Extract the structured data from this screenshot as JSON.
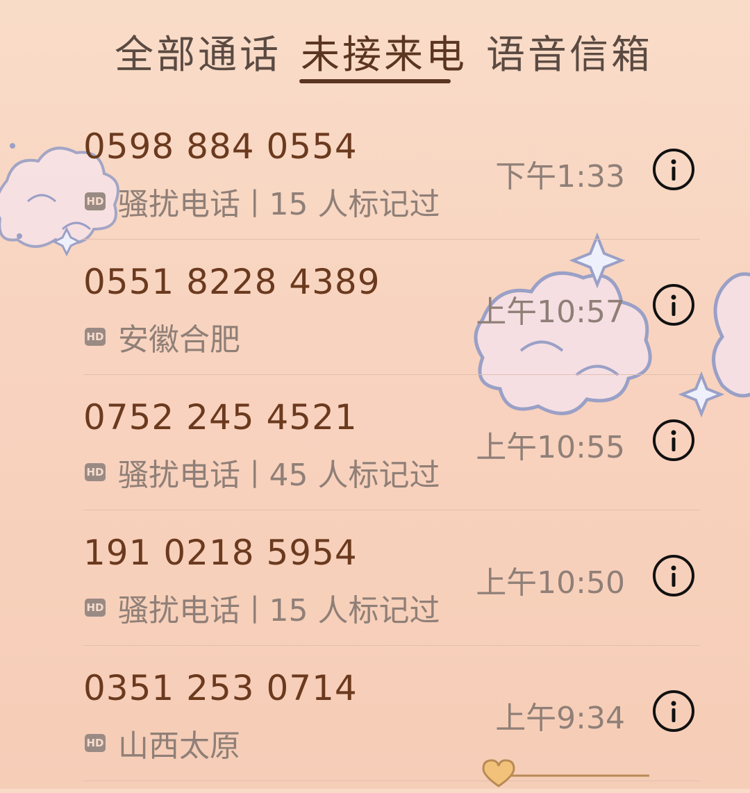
{
  "tabs": {
    "all": "全部通话",
    "missed": "未接来电",
    "voicemail": "语音信箱",
    "active": "missed"
  },
  "calls": [
    {
      "number": "0598 884 0554",
      "hd": "HD",
      "label": "骚扰电话",
      "separator": "|",
      "count": "15 人标记过",
      "time": "下午1:33"
    },
    {
      "number": "0551 8228 4389",
      "hd": "HD",
      "label": "安徽合肥",
      "time": "上午10:57"
    },
    {
      "number": "0752 245 4521",
      "hd": "HD",
      "label": "骚扰电话",
      "separator": "|",
      "count": "45 人标记过",
      "time": "上午10:55"
    },
    {
      "number": "191 0218 5954",
      "hd": "HD",
      "label": "骚扰电话",
      "separator": "|",
      "count": "15 人标记过",
      "time": "上午10:50"
    },
    {
      "number": "0351 253 0714",
      "hd": "HD",
      "label": "山西太原",
      "time": "上午9:34"
    }
  ],
  "icons": {
    "info": "info-icon",
    "hd": "hd-badge",
    "decor": "cloud-illustration"
  },
  "colors": {
    "accent": "#5a3520",
    "number": "#6b3a1e",
    "muted": "#8f7f77",
    "background": "#f8d5c1"
  }
}
